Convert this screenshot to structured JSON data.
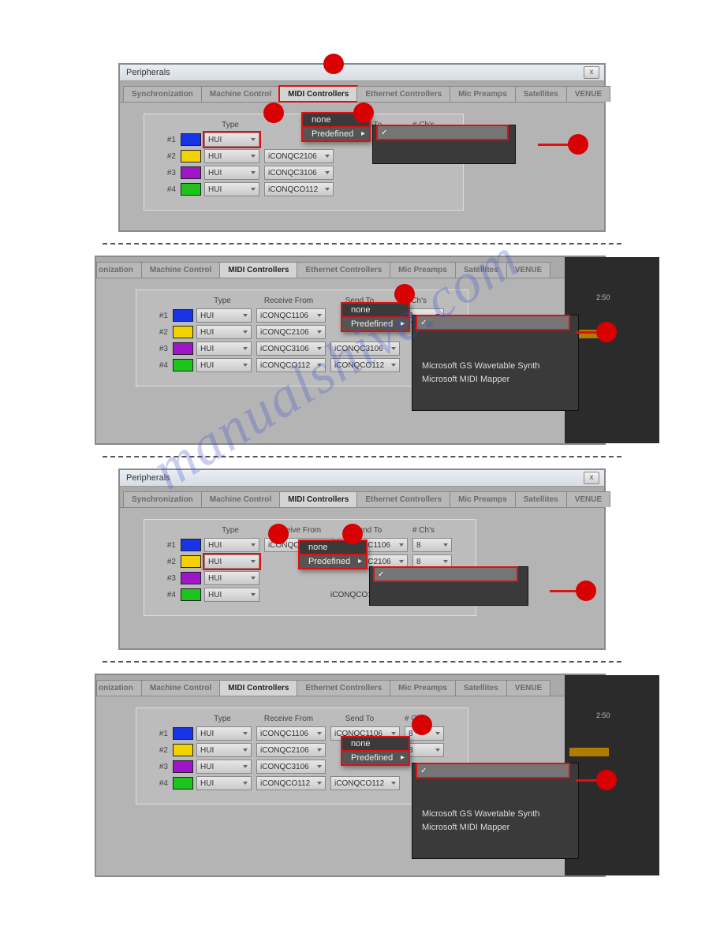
{
  "watermark": "manualshive.com",
  "window_title": "Peripherals",
  "close_glyph": "x",
  "tabs": {
    "sync": "Synchronization",
    "machine": "Machine Control",
    "midi": "MIDI Controllers",
    "ethernet": "Ethernet Controllers",
    "mic": "Mic Preamps",
    "sat": "Satellites",
    "venue": "VENUE"
  },
  "headers": {
    "type": "Type",
    "receive": "Receive From",
    "send": "Send To",
    "chs": "# Ch's"
  },
  "row_labels": {
    "r1": "#1",
    "r2": "#2",
    "r3": "#3",
    "r4": "#4"
  },
  "type_value": "HUI",
  "io": {
    "q1": "iCONQC1106",
    "q2": "iCONQC2106",
    "q3": "iCONQC3106",
    "q4": "iCONQCO112"
  },
  "ch_value": "8",
  "menu": {
    "none": "none",
    "predefined": "Predefined",
    "check": "✓"
  },
  "extra": {
    "gs": "Microsoft GS Wavetable Synth",
    "mapper": "Microsoft MIDI Mapper"
  },
  "timeline_label": "2:50"
}
